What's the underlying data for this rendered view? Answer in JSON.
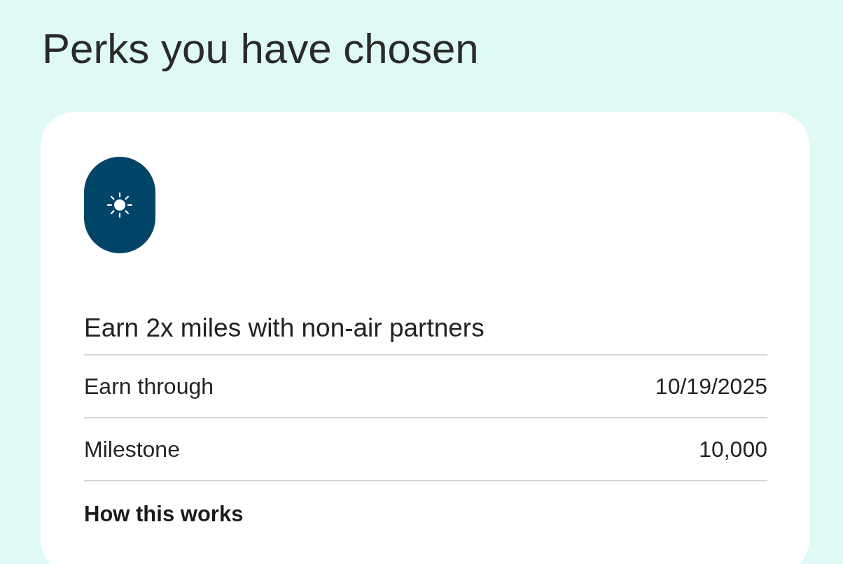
{
  "page_title": "Perks you have chosen",
  "perk": {
    "title": "Earn 2x miles with non-air partners",
    "details": [
      {
        "label": "Earn through",
        "value": "10/19/2025"
      },
      {
        "label": "Milestone",
        "value": "10,000"
      }
    ],
    "link": "How this works"
  }
}
